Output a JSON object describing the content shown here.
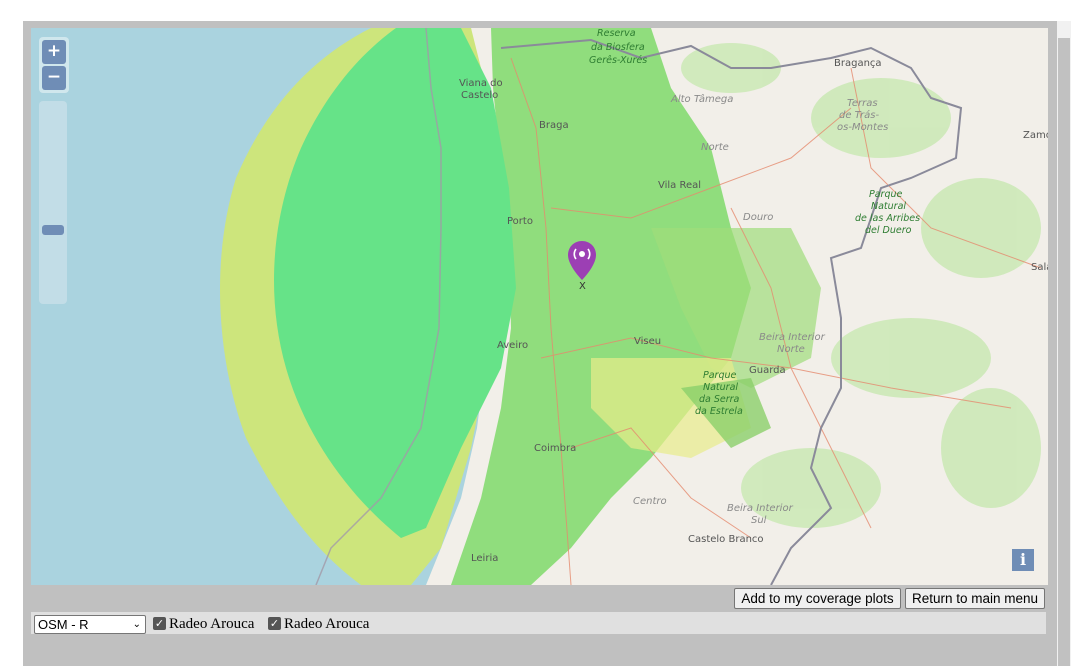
{
  "map": {
    "zoom_in_label": "+",
    "zoom_out_label": "−",
    "info_label": "i",
    "marker_label": "X",
    "places": {
      "viana": "Viana do",
      "viana2": "Castelo",
      "braga": "Braga",
      "braganca": "Bragança",
      "vila_real": "Vila Real",
      "porto": "Porto",
      "aveiro": "Aveiro",
      "viseu": "Viseu",
      "guarda": "Guarda",
      "coimbra": "Coimbra",
      "castelo_branco": "Castelo Branco",
      "leiria": "Leiria",
      "zamora": "Zamo",
      "salamanca": "Sala"
    },
    "regions": {
      "alto_tamega": "Alto Tâmega",
      "terras1": "Terras",
      "terras2": "de Trás-",
      "terras3": "os-Montes",
      "norte": "Norte",
      "douro": "Douro",
      "beira_norte1": "Beira Interior",
      "beira_norte2": "Norte",
      "centro": "Centro",
      "beira_sul1": "Beira Interior",
      "beira_sul2": "Sul"
    },
    "parks": {
      "geres1": "Reserva",
      "geres2": "da Biosfera",
      "geres3": "Gerês-Xurés",
      "arribes1": "Parque",
      "arribes2": "Natural",
      "arribes3": "de las Arribes",
      "arribes4": "del Duero",
      "estrela1": "Parque",
      "estrela2": "Natural",
      "estrela3": "da Serra",
      "estrela4": "da Estrela"
    }
  },
  "buttons": {
    "add_coverage": "Add to my coverage plots",
    "return_menu": "Return to main menu"
  },
  "controls": {
    "layer_selected": "OSM - R",
    "checkbox1_label": "Radeo Arouca",
    "checkbox2_label": "Radeo Arouca"
  },
  "colors": {
    "sea": "#aad3df",
    "land": "#f2efe9",
    "coverage_strong": "#66e388",
    "coverage_weak": "#cde57c",
    "marker": "#9c3fb4"
  }
}
